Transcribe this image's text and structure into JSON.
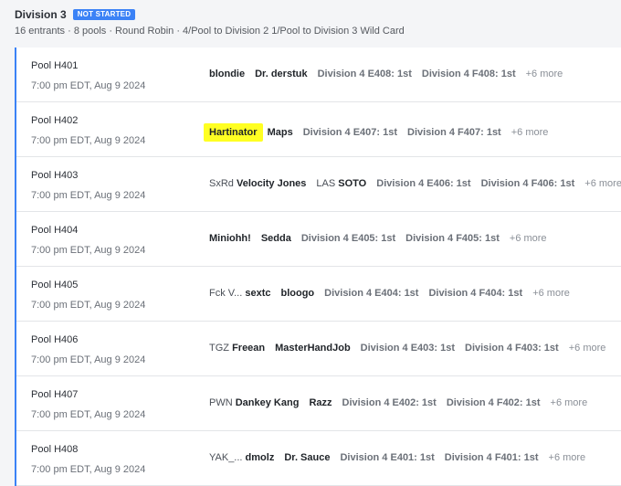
{
  "division": {
    "title": "Division 3",
    "status_badge": "NOT STARTED",
    "summary": "16 entrants · 8 pools · Round Robin · 4/Pool to Division 2 1/Pool to Division 3 Wild Card"
  },
  "colors": {
    "accent": "#3b82f6",
    "highlight": "#ffff22"
  },
  "pools": [
    {
      "name": "Pool H401",
      "time": "7:00 pm EDT, Aug 9 2024",
      "entrants": [
        {
          "prefix": "",
          "name": "blondie"
        },
        {
          "prefix": "",
          "name": "Dr. derstuk"
        }
      ],
      "seeds": [
        "Division 4 E408: 1st",
        "Division 4 F408: 1st"
      ],
      "more": "+6 more"
    },
    {
      "name": "Pool H402",
      "time": "7:00 pm EDT, Aug 9 2024",
      "entrants": [
        {
          "prefix": "",
          "name": "Hartinator",
          "highlighted": true
        },
        {
          "prefix": "",
          "name": "Maps"
        }
      ],
      "seeds": [
        "Division 4 E407: 1st",
        "Division 4 F407: 1st"
      ],
      "more": "+6 more"
    },
    {
      "name": "Pool H403",
      "time": "7:00 pm EDT, Aug 9 2024",
      "entrants": [
        {
          "prefix": "SxRd",
          "name": "Velocity Jones"
        },
        {
          "prefix": "LAS",
          "name": "SOTO"
        }
      ],
      "seeds": [
        "Division 4 E406: 1st",
        "Division 4 F406: 1st"
      ],
      "more": "+6 more"
    },
    {
      "name": "Pool H404",
      "time": "7:00 pm EDT, Aug 9 2024",
      "entrants": [
        {
          "prefix": "",
          "name": "Miniohh!"
        },
        {
          "prefix": "",
          "name": "Sedda"
        }
      ],
      "seeds": [
        "Division 4 E405: 1st",
        "Division 4 F405: 1st"
      ],
      "more": "+6 more"
    },
    {
      "name": "Pool H405",
      "time": "7:00 pm EDT, Aug 9 2024",
      "entrants": [
        {
          "prefix": "Fck V...",
          "name": "sextc"
        },
        {
          "prefix": "",
          "name": "bloogo"
        }
      ],
      "seeds": [
        "Division 4 E404: 1st",
        "Division 4 F404: 1st"
      ],
      "more": "+6 more"
    },
    {
      "name": "Pool H406",
      "time": "7:00 pm EDT, Aug 9 2024",
      "entrants": [
        {
          "prefix": "TGZ",
          "name": "Freean"
        },
        {
          "prefix": "",
          "name": "MasterHandJob"
        }
      ],
      "seeds": [
        "Division 4 E403: 1st",
        "Division 4 F403: 1st"
      ],
      "more": "+6 more"
    },
    {
      "name": "Pool H407",
      "time": "7:00 pm EDT, Aug 9 2024",
      "entrants": [
        {
          "prefix": "PWN",
          "name": "Dankey Kang"
        },
        {
          "prefix": "",
          "name": "Razz"
        }
      ],
      "seeds": [
        "Division 4 E402: 1st",
        "Division 4 F402: 1st"
      ],
      "more": "+6 more"
    },
    {
      "name": "Pool H408",
      "time": "7:00 pm EDT, Aug 9 2024",
      "entrants": [
        {
          "prefix": "YAK_...",
          "name": "dmolz"
        },
        {
          "prefix": "",
          "name": "Dr. Sauce"
        }
      ],
      "seeds": [
        "Division 4 E401: 1st",
        "Division 4 F401: 1st"
      ],
      "more": "+6 more"
    }
  ]
}
